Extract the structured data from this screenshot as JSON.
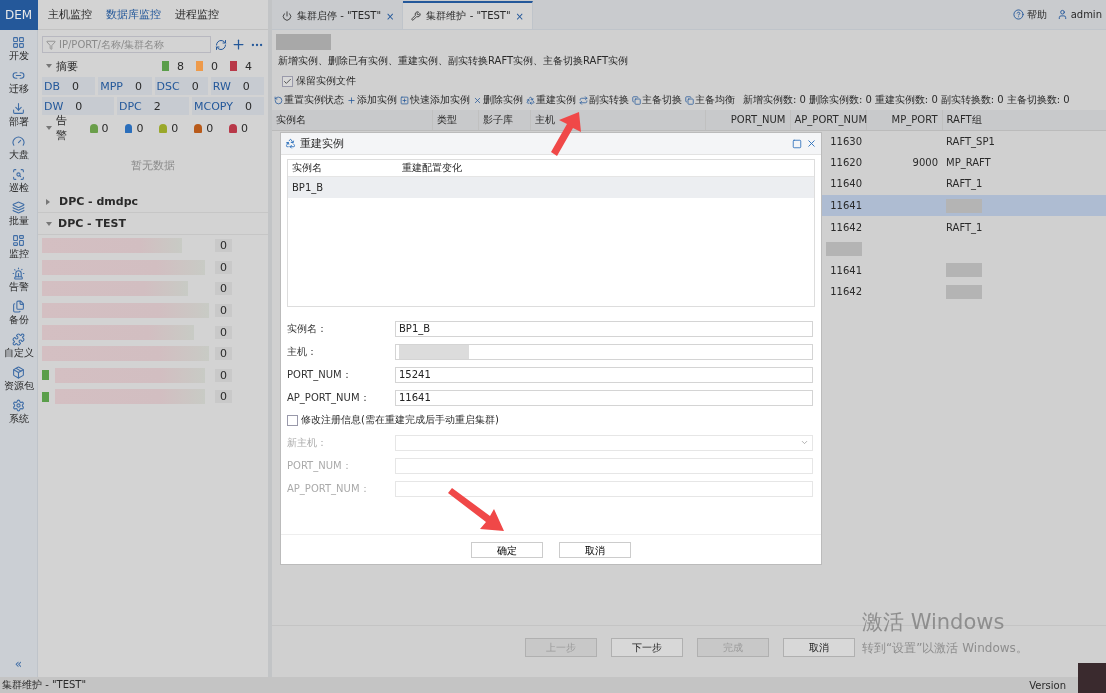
{
  "app": {
    "logo": "DEM"
  },
  "nav": [
    {
      "label": "开发",
      "kind": "grid"
    },
    {
      "label": "迁移",
      "kind": "link"
    },
    {
      "label": "部署",
      "kind": "deploy"
    },
    {
      "label": "大盘",
      "kind": "gauge"
    },
    {
      "label": "巡检",
      "kind": "inspect"
    },
    {
      "label": "批量",
      "kind": "batch"
    },
    {
      "label": "监控",
      "kind": "monitor"
    },
    {
      "label": "告警",
      "kind": "alarm"
    },
    {
      "label": "备份",
      "kind": "backup"
    },
    {
      "label": "自定义",
      "kind": "custom"
    },
    {
      "label": "资源包",
      "kind": "package"
    },
    {
      "label": "系统",
      "kind": "system"
    }
  ],
  "collapse": "«",
  "panel_tabs": [
    {
      "label": "主机监控",
      "selected": false
    },
    {
      "label": "数据库监控",
      "selected": true
    },
    {
      "label": "进程监控",
      "selected": false
    }
  ],
  "search": {
    "placeholder": "IP/PORT/名称/集群名称"
  },
  "summary": {
    "title": "摘要",
    "expanded": true,
    "counts": [
      {
        "value": "8",
        "color": "#5a9e4a"
      },
      {
        "value": "0",
        "color": "#ee9a4a"
      },
      {
        "value": "4",
        "color": "#b83848"
      }
    ]
  },
  "type_rows": [
    [
      {
        "label": "DB",
        "value": "0"
      },
      {
        "label": "MPP",
        "value": "0"
      },
      {
        "label": "DSC",
        "value": "0"
      },
      {
        "label": "RW",
        "value": "0"
      }
    ],
    [
      {
        "label": "DW",
        "value": "0"
      },
      {
        "label": "DPC",
        "value": "2"
      },
      {
        "label": "MCOPY",
        "value": "0"
      }
    ]
  ],
  "alarms": {
    "title": "告警",
    "expanded": true,
    "levels": [
      {
        "value": "0",
        "color": "#6a9e4a"
      },
      {
        "value": "0",
        "color": "#2a6ebb"
      },
      {
        "value": "0",
        "color": "#9aa82a"
      },
      {
        "value": "0",
        "color": "#b85a1a"
      },
      {
        "value": "0",
        "color": "#b83848"
      }
    ]
  },
  "empty_text": "暂无数据",
  "groups": [
    {
      "title": "DPC - dmdpc",
      "expanded": false
    },
    {
      "title": "DPC - TEST",
      "expanded": true,
      "members": [
        {
          "kind": "plain",
          "count": "0"
        },
        {
          "kind": "plain",
          "count": "0"
        },
        {
          "kind": "plain",
          "count": "0"
        },
        {
          "kind": "plain",
          "count": "0"
        },
        {
          "kind": "plain",
          "count": "0"
        },
        {
          "kind": "plain",
          "count": "0"
        },
        {
          "kind": "status",
          "count": "0"
        },
        {
          "kind": "status",
          "count": "0"
        }
      ]
    }
  ],
  "tabs": [
    {
      "title": "集群启停 - \"TEST\"",
      "kind": "power",
      "selected": false,
      "close": "×"
    },
    {
      "title": "集群维护 - \"TEST\"",
      "kind": "wrench",
      "selected": true,
      "close": "×"
    }
  ],
  "header": {
    "help": "帮助",
    "user": "admin"
  },
  "description": "新增实例、删除已有实例、重建实例、副实转换RAFT实例、主备切换RAFT实例",
  "keep_files": {
    "label": "保留实例文件",
    "checked": true
  },
  "toolbar": [
    {
      "label": "重置实例状态",
      "kind": "reset"
    },
    {
      "label": "添加实例",
      "kind": "add"
    },
    {
      "label": "快速添加实例",
      "kind": "quick"
    },
    {
      "label": "删除实例",
      "kind": "delete"
    },
    {
      "label": "重建实例",
      "kind": "rebuild"
    },
    {
      "label": "副实转换",
      "kind": "convert"
    },
    {
      "label": "主备切换",
      "kind": "switch"
    },
    {
      "label": "主备均衡",
      "kind": "switch"
    }
  ],
  "stats": [
    "新增实例数: 0",
    "删除实例数: 0",
    "重建实例数: 0",
    "副实转换数: 0",
    "主备切换数: 0"
  ],
  "table": {
    "columns": [
      "实例名",
      "类型",
      "影子库",
      "主机",
      "PORT_NUM",
      "AP_PORT_NUM",
      "MP_PORT",
      "RAFT组"
    ],
    "rows": [
      {
        "selected": false,
        "ap_port_num": "11630",
        "raft_group": "RAFT_SP1"
      },
      {
        "selected": false,
        "ap_port_num": "11620",
        "mp_port": "9000",
        "raft_group": "MP_RAFT"
      },
      {
        "selected": false,
        "ap_port_num": "11640",
        "raft_group": "RAFT_1"
      },
      {
        "selected": true,
        "ap_port_num": "11641",
        "raft_group_redacted": true
      },
      {
        "selected": false,
        "ap_port_num": "11642",
        "raft_group": "RAFT_1"
      },
      {
        "selected": false,
        "ap_port_num_redacted": true
      },
      {
        "selected": false,
        "ap_port_num": "11641",
        "raft_group_redacted": true
      },
      {
        "selected": false,
        "ap_port_num": "11642",
        "raft_group_redacted": true
      }
    ]
  },
  "dialog": {
    "title": "重建实例",
    "columns": [
      "实例名",
      "重建配置变化"
    ],
    "rows": [
      {
        "name": "BP1_B",
        "selected": true
      }
    ],
    "fields": [
      {
        "label": "实例名：",
        "value": "BP1_B"
      },
      {
        "label": "主机：",
        "redacted": true
      },
      {
        "label": "PORT_NUM：",
        "value": "15241"
      },
      {
        "label": "AP_PORT_NUM：",
        "value": "11641"
      }
    ],
    "modify": {
      "label": "修改注册信息(需在重建完成后手动重启集群)",
      "checked": false
    },
    "new_fields": [
      {
        "label": "新主机：",
        "kind": "select",
        "disabled": true
      },
      {
        "label": "PORT_NUM：",
        "kind": "text",
        "disabled": true
      },
      {
        "label": "AP_PORT_NUM：",
        "kind": "text",
        "disabled": true
      }
    ],
    "buttons": [
      {
        "label": "确定"
      },
      {
        "label": "取消"
      }
    ]
  },
  "wizard": [
    {
      "label": "上一步",
      "disabled": true
    },
    {
      "label": "下一步",
      "disabled": false
    },
    {
      "label": "完成",
      "disabled": true
    },
    {
      "label": "取消",
      "disabled": false
    }
  ],
  "status_bar": {
    "text": "集群维护 - \"TEST\"",
    "version": "Version"
  },
  "watermark": {
    "title": "激活 Windows",
    "subtitle": "转到“设置”以激活 Windows。"
  }
}
